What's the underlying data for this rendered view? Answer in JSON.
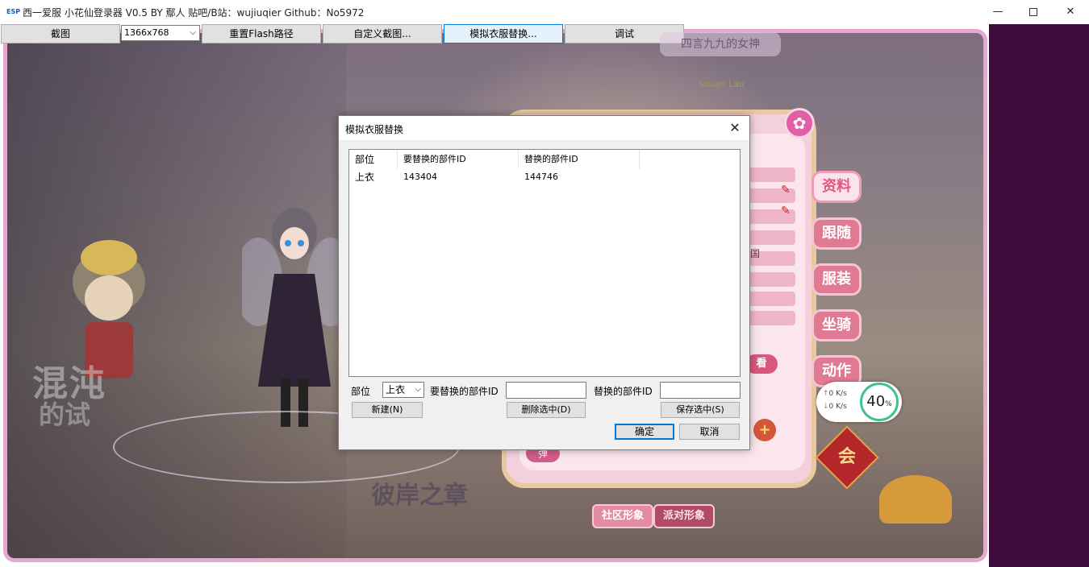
{
  "window": {
    "title": "西一爱服 小花仙登录器 V0.5 BY 鄢人 贴吧/B站：wujiuqier Github：No5972",
    "icon_text": "ESP"
  },
  "toolbar": {
    "screenshot_label": "截图",
    "resolution_value": "1366x768",
    "reset_flash_label": "重置Flash路径",
    "custom_screenshot_label": "自定义截图...",
    "costume_replace_label": "模拟衣服替换...",
    "debug_label": "调试"
  },
  "game": {
    "nameplate_title": "四言九九的女神",
    "nameplate_sub": "Susan Lau",
    "region": "国",
    "inspect_label": "看",
    "danmu_label": "弹",
    "logo_left_line1": "混沌",
    "logo_left_line2": "的试",
    "logo_right": "彼岸之章",
    "side_tabs": [
      "资料",
      "跟随",
      "服装",
      "坐骑",
      "动作"
    ],
    "bottom_tabs": [
      "社区形象",
      "派对形象"
    ],
    "badge_label": "会",
    "speed": {
      "upload": "0  K/s",
      "download": "0  K/s",
      "percent": "40",
      "percent_unit": "%"
    }
  },
  "dialog": {
    "title": "模拟衣服替换",
    "close_glyph": "✕",
    "table": {
      "columns": [
        "部位",
        "要替换的部件ID",
        "替换的部件ID"
      ],
      "rows": [
        {
          "part": "上衣",
          "target_id": "143404",
          "replace_id": "144746"
        }
      ]
    },
    "form": {
      "part_label": "部位",
      "part_value": "上衣",
      "target_id_label": "要替换的部件ID",
      "target_id_value": "",
      "replace_id_label": "替换的部件ID",
      "replace_id_value": ""
    },
    "buttons": {
      "new": "新建(N)",
      "delete_selected": "删除选中(D)",
      "save_selected": "保存选中(S)",
      "ok": "确定",
      "cancel": "取消"
    }
  },
  "colors": {
    "frame_border": "#e5a9cf",
    "outer_purple": "#3f0b3a",
    "panel_pink": "#f4d0dd",
    "accent_blue": "#0078d7",
    "speed_green": "#3fc28b"
  },
  "icons": {
    "app": "app-logo-icon",
    "minimize": "minimize-icon",
    "maximize": "maximize-icon",
    "close": "close-icon",
    "dropdown": "chevron-down-icon",
    "pencil": "pencil-icon",
    "add": "plus-icon",
    "upload": "arrow-up-icon",
    "download": "arrow-down-icon"
  }
}
